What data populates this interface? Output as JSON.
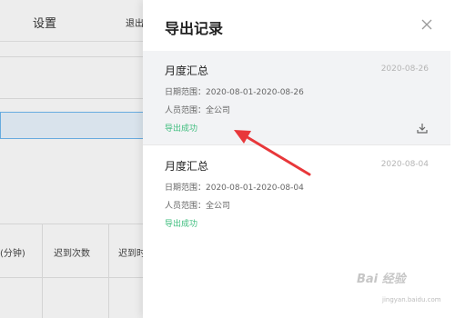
{
  "background": {
    "tabs": [
      "设置",
      "退出"
    ],
    "table_headers": [
      "(分钟)",
      "迟到次数",
      "迟到时"
    ]
  },
  "drawer": {
    "title": "导出记录",
    "records": [
      {
        "title": "月度汇总",
        "date": "2020-08-26",
        "date_range": "日期范围：2020-08-01-2020-08-26",
        "people_range": "人员范围：全公司",
        "status": "导出成功",
        "has_download": true
      },
      {
        "title": "月度汇总",
        "date": "2020-08-04",
        "date_range": "日期范围：2020-08-01-2020-08-04",
        "people_range": "人员范围：全公司",
        "status": "导出成功",
        "has_download": false
      }
    ]
  },
  "watermark": {
    "text": "Bai 经验",
    "sub": "jingyan.baidu.com"
  },
  "colors": {
    "status_success": "#3dbd7d",
    "arrow": "#e8373a",
    "selected_row_bg": "#f2f3f5",
    "highlight_border": "#6fb9f0"
  },
  "icons": {
    "close": "close-icon",
    "download": "download-icon",
    "annotation": "red-arrow"
  }
}
